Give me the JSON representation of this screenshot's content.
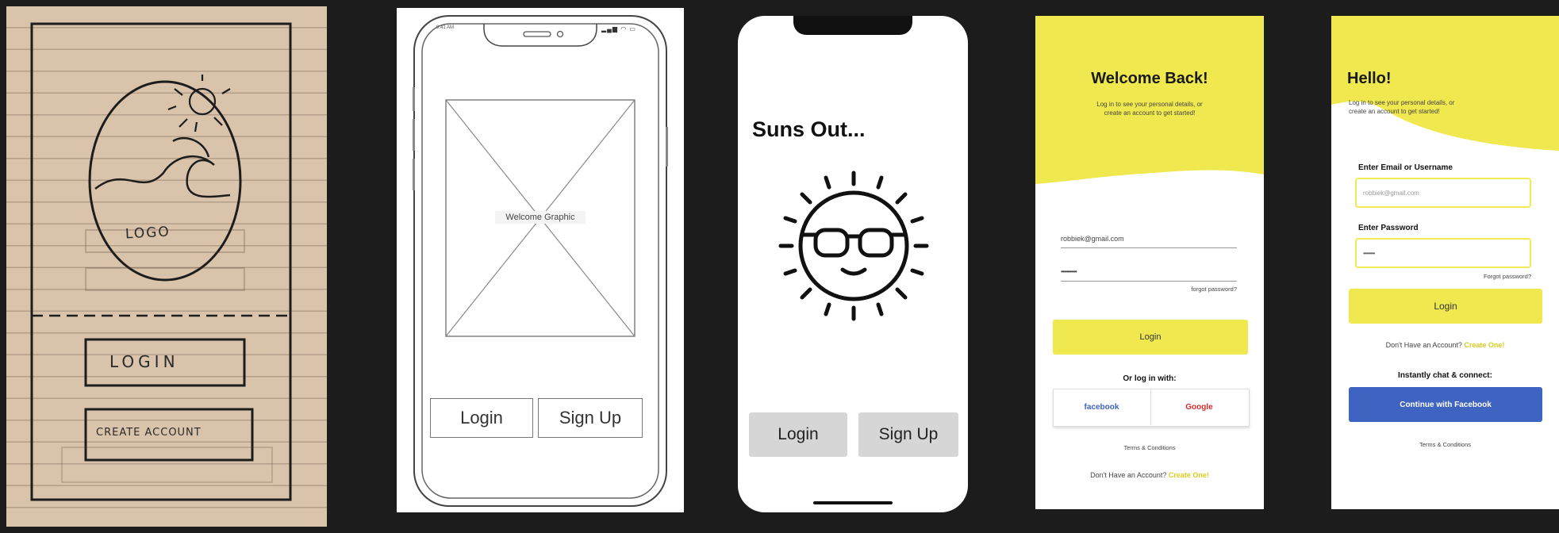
{
  "sketch": {
    "logo_label": "LOGO",
    "login_label": "LOGIN",
    "create_label": "CREATE ACCOUNT"
  },
  "wireframe": {
    "image_label": "Welcome Graphic",
    "login_label": "Login",
    "signup_label": "Sign Up"
  },
  "suns": {
    "title": "Suns Out...",
    "login_label": "Login",
    "signup_label": "Sign Up"
  },
  "welcome": {
    "title": "Welcome Back!",
    "subtitle_line1": "Log in to see your personal details, or",
    "subtitle_line2": "create an account to get started!",
    "email_value": "robbiek@gmail.com",
    "password_value": "•••••••••••",
    "forgot_label": "forgot password?",
    "login_label": "Login",
    "or_label": "Or log in with:",
    "facebook_label": "facebook",
    "google_label": "Google",
    "terms_label": "Terms & Conditions",
    "no_account_label": "Don't Have an Account?",
    "create_label": "Create One!"
  },
  "hello": {
    "title": "Hello!",
    "subtitle_line1": "Log in to see your personal details, or",
    "subtitle_line2": "create an account to get started!",
    "email_label": "Enter Email or Username",
    "email_value": "robbiek@gmail.com",
    "password_label": "Enter Password",
    "password_value": "••••••••",
    "forgot_label": "Forgot password?",
    "login_label": "Login",
    "no_account_label": "Don't Have an Account?",
    "create_label": "Create One!",
    "chat_label": "Instantly chat & connect:",
    "facebook_label": "Continue with Facebook",
    "terms_label": "Terms & Conditions"
  },
  "colors": {
    "background": "#1c1c1c",
    "accent_yellow": "#efe84e",
    "facebook_blue": "#3f63c0",
    "google_red": "#d42a2a",
    "link_yellow": "#d9cc22"
  },
  "icons": [
    "notch-icon",
    "sun-sunglasses-icon",
    "wave-logo-sketch",
    "image-placeholder-icon",
    "status-bar-icons"
  ]
}
